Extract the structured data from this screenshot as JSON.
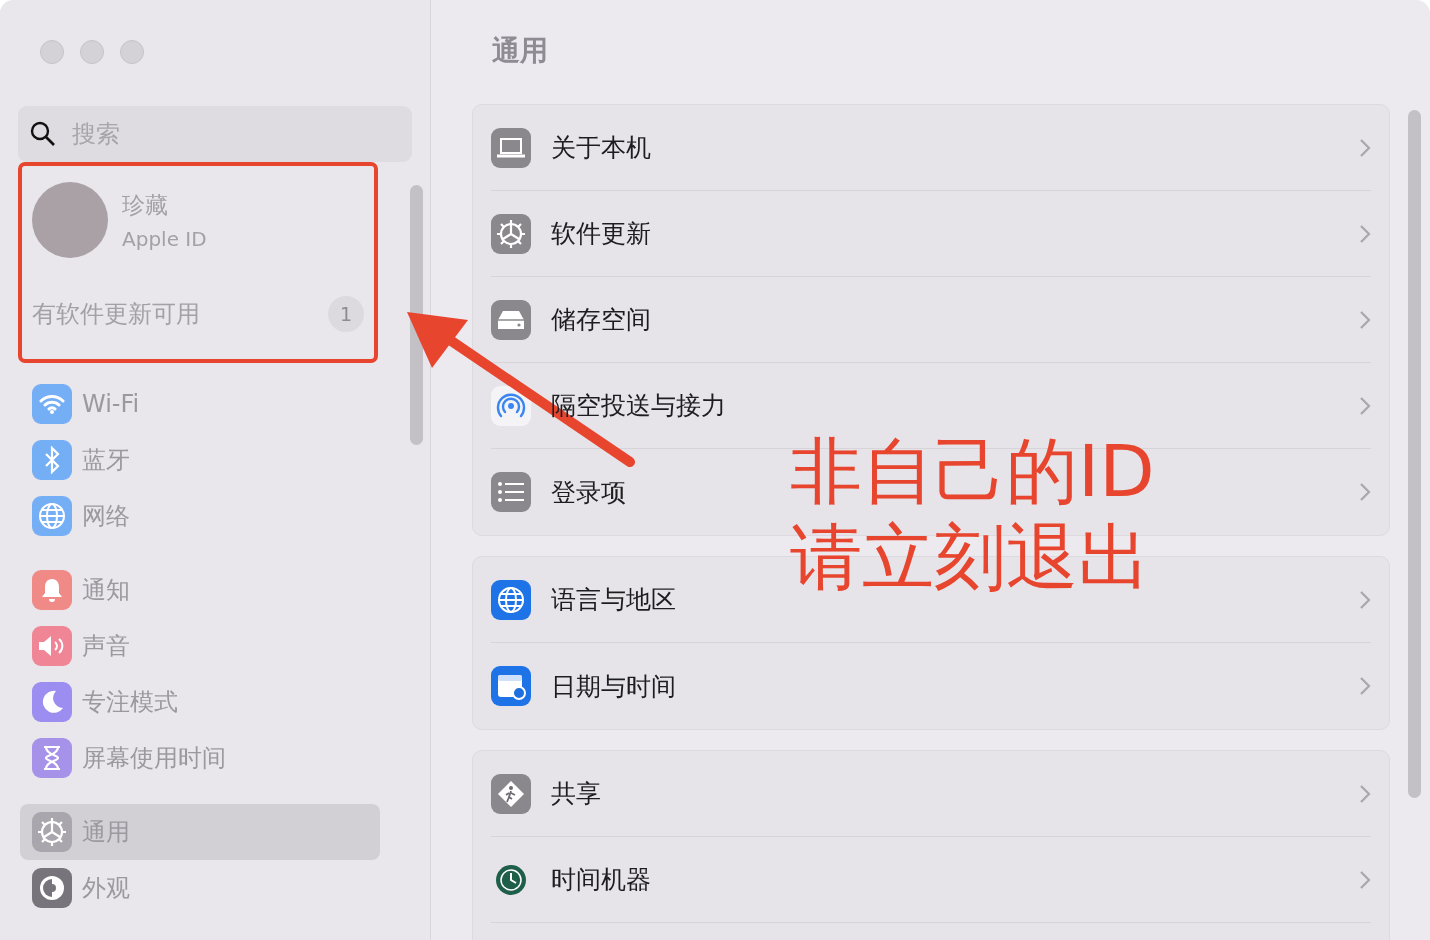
{
  "sidebar": {
    "search": {
      "placeholder": "搜索"
    },
    "account": {
      "name": "珍藏",
      "subtitle": "Apple ID",
      "notice": "有软件更新可用",
      "badge": "1"
    },
    "groups": [
      [
        {
          "label": "Wi-Fi",
          "kind": "wifi",
          "color": "#74aef5",
          "selected": false
        },
        {
          "label": "蓝牙",
          "kind": "bluetooth",
          "color": "#74aef5",
          "selected": false
        },
        {
          "label": "网络",
          "kind": "globe",
          "color": "#74aef5",
          "selected": false
        }
      ],
      [
        {
          "label": "通知",
          "kind": "bell",
          "color": "#f08a86",
          "selected": false
        },
        {
          "label": "声音",
          "kind": "speaker",
          "color": "#f08596",
          "selected": false
        },
        {
          "label": "专注模式",
          "kind": "moon",
          "color": "#9b8ef0",
          "selected": false
        },
        {
          "label": "屏幕使用时间",
          "kind": "hourglass",
          "color": "#a692e8",
          "selected": false
        }
      ],
      [
        {
          "label": "通用",
          "kind": "gear",
          "color": "#a9a7ad",
          "selected": true
        },
        {
          "label": "外观",
          "kind": "appearance",
          "color": "#77757b",
          "selected": false
        }
      ]
    ]
  },
  "main": {
    "title": "通用",
    "groups": [
      [
        {
          "label": "关于本机",
          "kind": "laptop"
        },
        {
          "label": "软件更新",
          "kind": "gear"
        },
        {
          "label": "储存空间",
          "kind": "drive"
        },
        {
          "label": "隔空投送与接力",
          "kind": "airdrop"
        },
        {
          "label": "登录项",
          "kind": "list"
        }
      ],
      [
        {
          "label": "语言与地区",
          "kind": "globe"
        },
        {
          "label": "日期与时间",
          "kind": "calendar"
        }
      ],
      [
        {
          "label": "共享",
          "kind": "sharing"
        },
        {
          "label": "时间机器",
          "kind": "clock"
        },
        {
          "kind": "blank"
        }
      ]
    ]
  },
  "annotation": {
    "lines": [
      "非自己的ID",
      "请立刻退出"
    ]
  }
}
